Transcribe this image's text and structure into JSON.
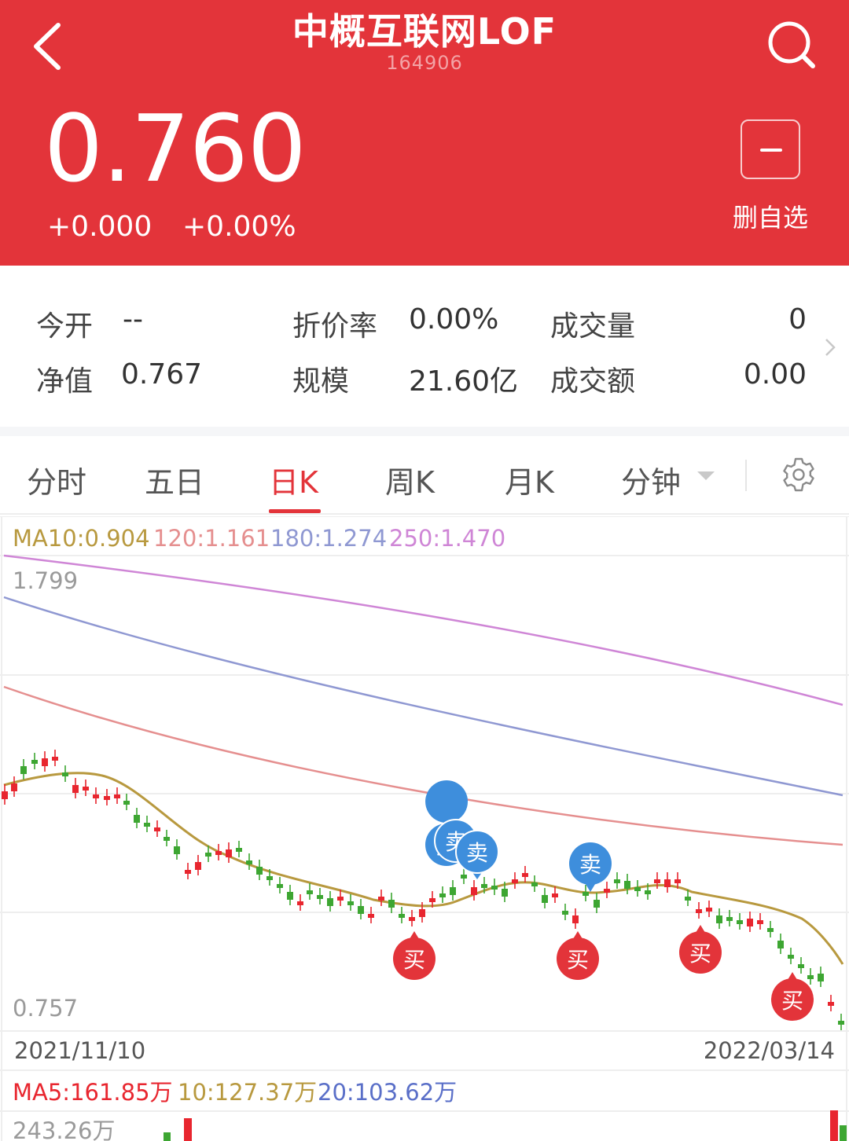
{
  "header": {
    "title": "中概互联网LOF",
    "code": "164906",
    "price": "0.760",
    "change": "+0.000",
    "change_pct": "+0.00%",
    "watch_label": "删自选"
  },
  "stats": {
    "open_label": "今开",
    "open_value": "--",
    "nav_label": "净值",
    "nav_value": "0.767",
    "discount_label": "折价率",
    "discount_value": "0.00%",
    "scale_label": "规模",
    "scale_value": "21.60亿",
    "volume_label": "成交量",
    "volume_value": "0",
    "amount_label": "成交额",
    "amount_value": "0.00"
  },
  "tabs": [
    {
      "label": "分时"
    },
    {
      "label": "五日"
    },
    {
      "label": "日K"
    },
    {
      "label": "周K"
    },
    {
      "label": "月K"
    },
    {
      "label": "分钟"
    }
  ],
  "chart_data": {
    "type": "candlestick",
    "legend": {
      "ma10": "MA10:0.904",
      "ma120": "120:1.161",
      "ma180": "180:1.274",
      "ma250": "250:1.470"
    },
    "y_max_label": "1.799",
    "y_min_label": "0.757",
    "ylim": [
      0.757,
      1.799
    ],
    "x_start": "2021/11/10",
    "x_end": "2022/03/14",
    "signals": {
      "buy_label": "买",
      "sell_label": "卖"
    },
    "volume_legend": {
      "ma5": "MA5:161.85万",
      "ma10": "10:127.37万",
      "ma20": "20:103.62万"
    },
    "volume_max_label": "243.26万"
  },
  "colors": {
    "brand_red": "#e3343a",
    "ma10": "#b8993f",
    "ma120": "#e58f8f",
    "ma180": "#8f98d2",
    "ma250": "#cf86d6",
    "up": "#e8262f",
    "down": "#3da632",
    "sell_pin": "#3e8edc",
    "buy_pin": "#e3343a"
  }
}
